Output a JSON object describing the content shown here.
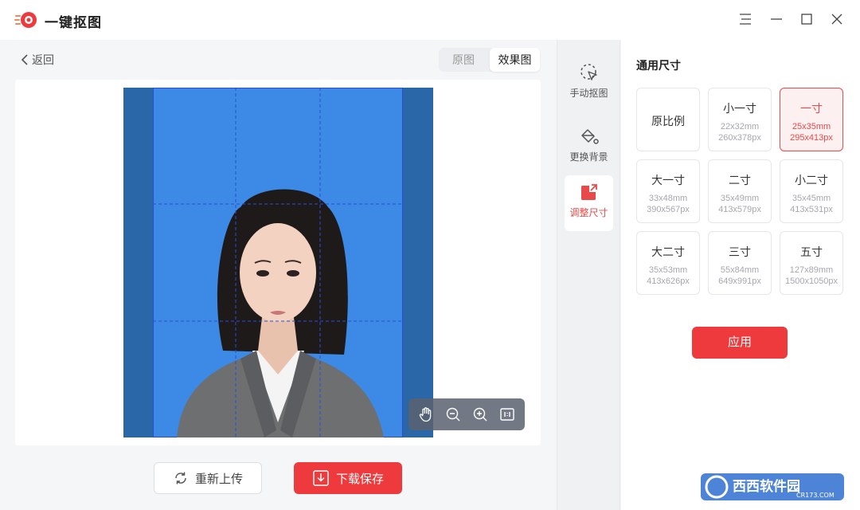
{
  "app": {
    "title": "一键抠图",
    "brand_color": "#ee3a3c",
    "window_controls": [
      "menu-icon",
      "minimize-icon",
      "maximize-icon",
      "close-icon"
    ]
  },
  "workspace": {
    "back_label": "返回",
    "view_tabs": [
      {
        "label": "原图",
        "active": false
      },
      {
        "label": "效果图",
        "active": true
      }
    ],
    "photo_background_color": "#3c8ae6",
    "zoom_tools": [
      "hand-icon",
      "zoom-out-icon",
      "zoom-in-icon",
      "fit-screen-icon"
    ],
    "reupload_label": "重新上传",
    "download_label": "下载保存"
  },
  "tools": [
    {
      "label": "手动抠图",
      "icon": "cursor-select-icon",
      "active": false
    },
    {
      "label": "更换背景",
      "icon": "paint-bucket-icon",
      "active": false
    },
    {
      "label": "调整尺寸",
      "icon": "resize-icon",
      "active": true
    }
  ],
  "size_panel": {
    "title": "通用尺寸",
    "sizes": [
      {
        "name": "原比例",
        "mm": "",
        "px": "",
        "selected": false
      },
      {
        "name": "小一寸",
        "mm": "22x32mm",
        "px": "260x378px",
        "selected": false
      },
      {
        "name": "一寸",
        "mm": "25x35mm",
        "px": "295x413px",
        "selected": true
      },
      {
        "name": "大一寸",
        "mm": "33x48mm",
        "px": "390x567px",
        "selected": false
      },
      {
        "name": "二寸",
        "mm": "35x49mm",
        "px": "413x579px",
        "selected": false
      },
      {
        "name": "小二寸",
        "mm": "35x45mm",
        "px": "413x531px",
        "selected": false
      },
      {
        "name": "大二寸",
        "mm": "35x53mm",
        "px": "413x626px",
        "selected": false
      },
      {
        "name": "三寸",
        "mm": "55x84mm",
        "px": "649x991px",
        "selected": false
      },
      {
        "name": "五寸",
        "mm": "127x89mm",
        "px": "1500x1050px",
        "selected": false
      }
    ],
    "apply_label": "应用"
  },
  "watermark": {
    "text": "西西软件园",
    "url_text": "CR173.COM"
  }
}
